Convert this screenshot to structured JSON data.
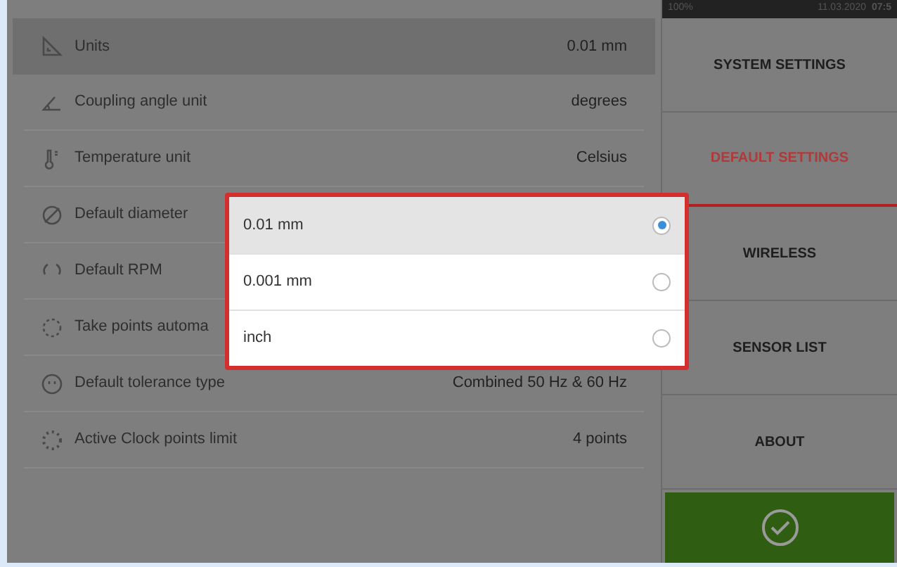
{
  "status_bar": {
    "battery": "100%",
    "date": "11.03.2020",
    "time": "07:5"
  },
  "settings": [
    {
      "kind": "ruler",
      "label": "Units",
      "value": "0.01 mm",
      "selected": true
    },
    {
      "kind": "angle",
      "label": "Coupling angle unit",
      "value": "degrees",
      "selected": false
    },
    {
      "kind": "thermometer",
      "label": "Temperature unit",
      "value": "Celsius",
      "selected": false
    },
    {
      "kind": "diameter",
      "label": "Default diameter",
      "selected": false
    },
    {
      "kind": "rpm",
      "label": "Default RPM",
      "selected": false
    },
    {
      "kind": "auto",
      "label": "Take points automa",
      "selected": false
    },
    {
      "kind": "smiley",
      "label": "Default tolerance type",
      "value": "Combined 50 Hz & 60 Hz",
      "selected": false
    },
    {
      "kind": "clock",
      "label": "Active Clock points limit",
      "value": "4 points",
      "selected": false
    }
  ],
  "dropdown": {
    "options": [
      {
        "label": "0.01 mm",
        "selected": true
      },
      {
        "label": "0.001 mm",
        "selected": false
      },
      {
        "label": "inch",
        "selected": false
      }
    ]
  },
  "menu": [
    {
      "label": "SYSTEM SETTINGS",
      "selected": false
    },
    {
      "label": "DEFAULT SETTINGS",
      "selected": true
    },
    {
      "label": "WIRELESS",
      "selected": false
    },
    {
      "label": "SENSOR LIST",
      "selected": false
    },
    {
      "label": "ABOUT",
      "selected": false
    }
  ]
}
